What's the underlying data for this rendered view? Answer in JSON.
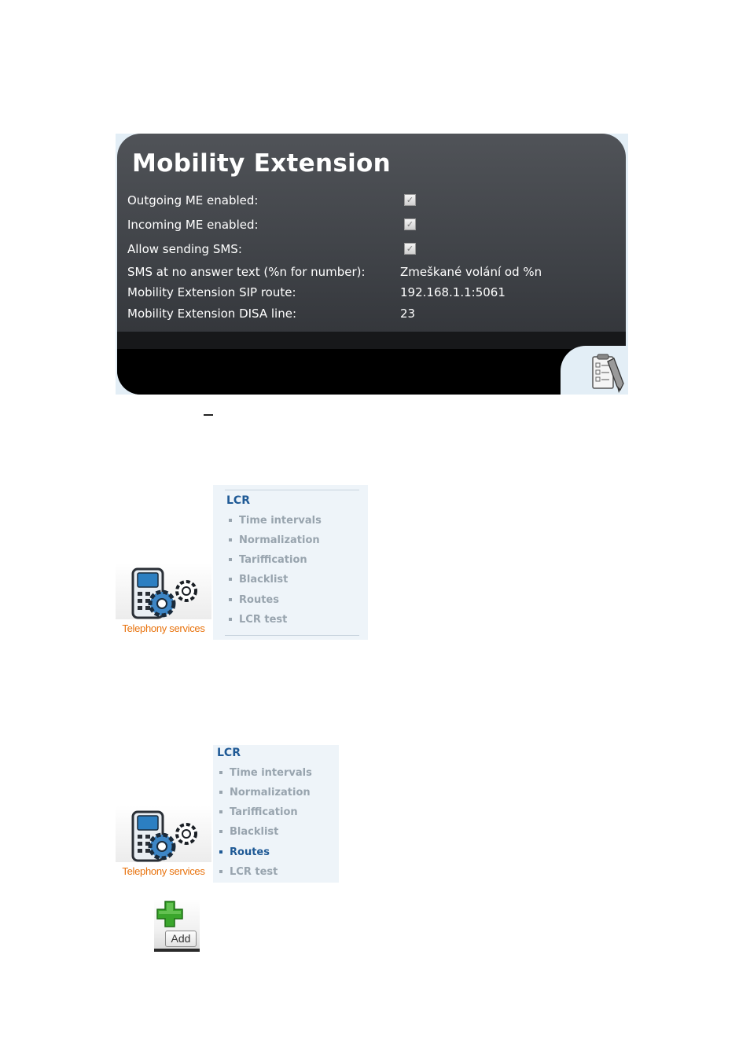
{
  "mobility_extension": {
    "title": "Mobility Extension",
    "rows": [
      {
        "label": "Outgoing ME enabled:",
        "checked": true
      },
      {
        "label": "Incoming ME enabled:",
        "checked": true
      },
      {
        "label": "Allow sending SMS:",
        "checked": true
      },
      {
        "label": "SMS at no answer text (%n for number):",
        "value": "Zmeškané volání od %n"
      },
      {
        "label": "Mobility Extension SIP route:",
        "value": "192.168.1.1:5061"
      },
      {
        "label": "Mobility Extension DISA line:",
        "value": "23"
      }
    ],
    "edit_icon": "clipboard-edit-icon",
    "check_glyph": "✓"
  },
  "telephony_services": {
    "label": "Telephony services",
    "icon": "phone-gears-icon"
  },
  "lcr_menu_1": {
    "heading": "LCR",
    "items": [
      "Time intervals",
      "Normalization",
      "Tariffication",
      "Blacklist",
      "Routes",
      "LCR test"
    ]
  },
  "lcr_menu_2": {
    "heading": "LCR",
    "items": [
      "Time intervals",
      "Normalization",
      "Tariffication",
      "Blacklist",
      "Routes",
      "LCR test"
    ],
    "active_item": "Routes"
  },
  "add_button": {
    "label": "Add",
    "icon": "green-plus-icon"
  },
  "colors": {
    "panel_bg": "#3d4045",
    "menu_bg": "#eef4f9",
    "menu_heading": "#1f5a96",
    "menu_item": "#98a4ae",
    "telephony_label": "#e8720c",
    "plus_green": "#3aa62c"
  }
}
